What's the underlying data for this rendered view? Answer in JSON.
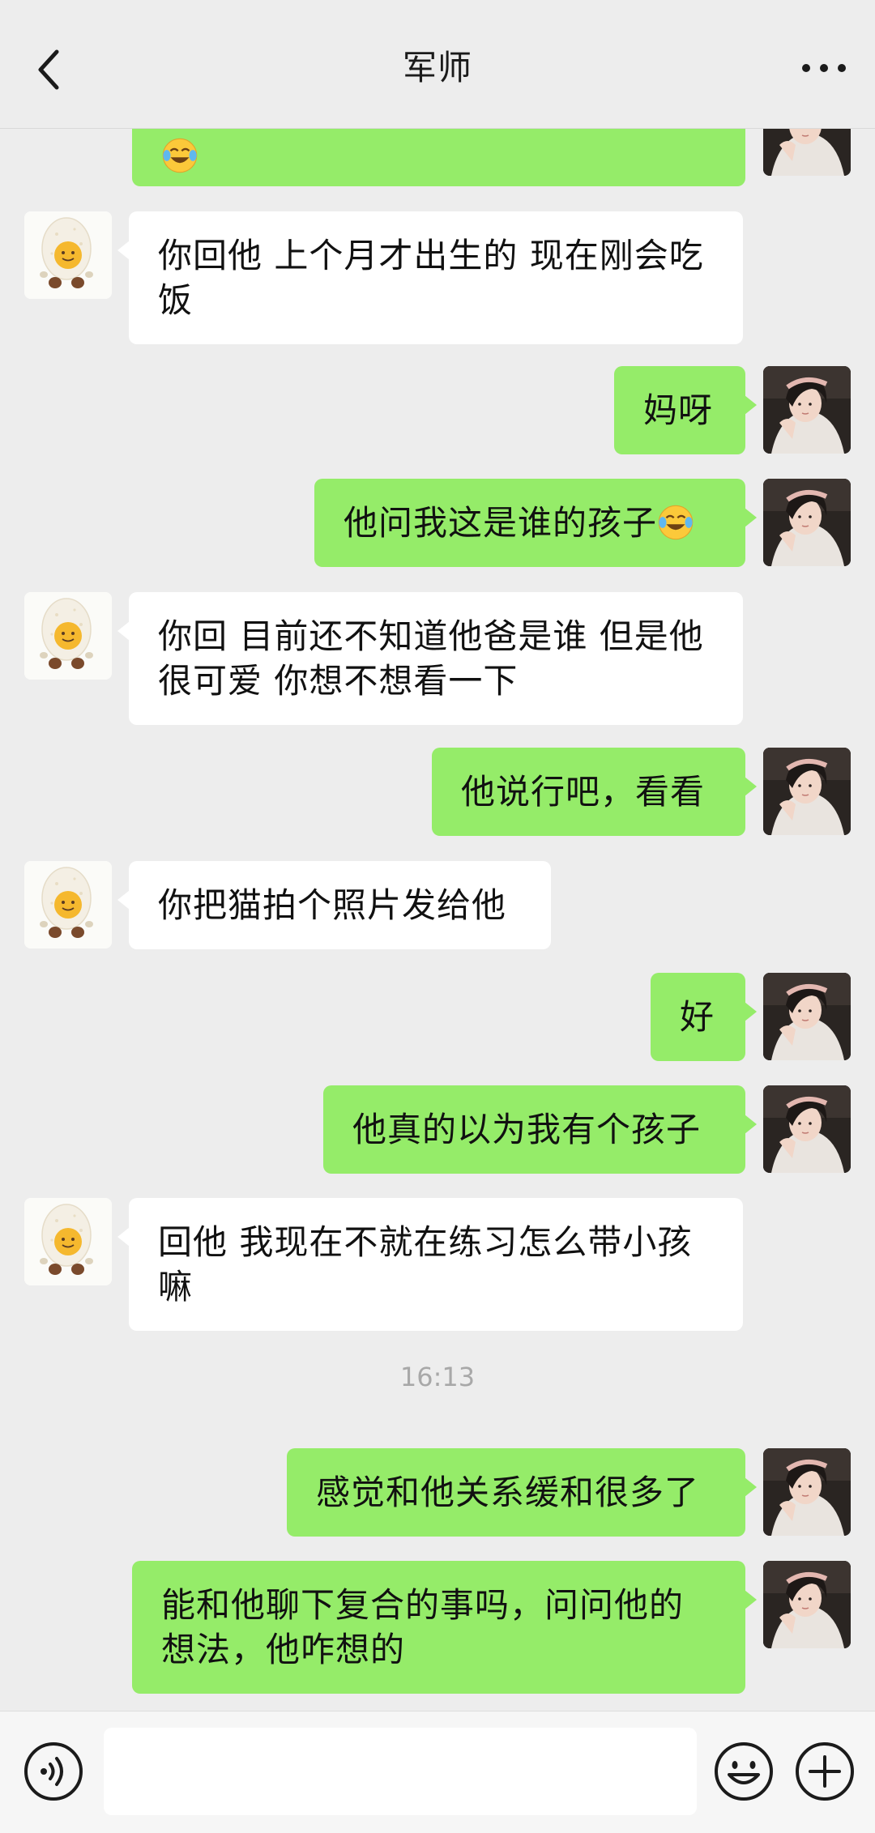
{
  "header": {
    "title": "军师"
  },
  "icons": {
    "back": "chevron-left-icon",
    "more": "more-horizontal-icon",
    "voice": "voice-icon",
    "emoji": "smiley-icon",
    "plus": "plus-icon",
    "cry_laugh": "face-with-tears-of-joy-emoji"
  },
  "colors": {
    "background": "#ededed",
    "incoming_bubble": "#ffffff",
    "outgoing_bubble": "#95ec69",
    "timestamp": "#a8a8a8"
  },
  "messages": [
    {
      "from": "self",
      "text": "",
      "emoji": "face-with-tears-of-joy"
    },
    {
      "from": "contact",
      "text": "你回他 上个月才出生的 现在刚会吃饭"
    },
    {
      "from": "self",
      "text": "妈呀"
    },
    {
      "from": "self",
      "text": "他问我这是谁的孩子",
      "emoji": "face-with-tears-of-joy"
    },
    {
      "from": "contact",
      "text": "你回 目前还不知道他爸是谁 但是他很可爱 你想不想看一下"
    },
    {
      "from": "self",
      "text": "他说行吧，看看"
    },
    {
      "from": "contact",
      "text": "你把猫拍个照片发给他"
    },
    {
      "from": "self",
      "text": "好"
    },
    {
      "from": "self",
      "text": "他真的以为我有个孩子"
    },
    {
      "from": "contact",
      "text": "回他 我现在不就在练习怎么带小孩嘛"
    },
    {
      "from": "self",
      "text": "感觉和他关系缓和很多了"
    },
    {
      "from": "self",
      "text": "能和他聊下复合的事吗，问问他的想法，他咋想的"
    }
  ],
  "timestamp": "16:13",
  "input": {
    "value": "",
    "placeholder": ""
  }
}
